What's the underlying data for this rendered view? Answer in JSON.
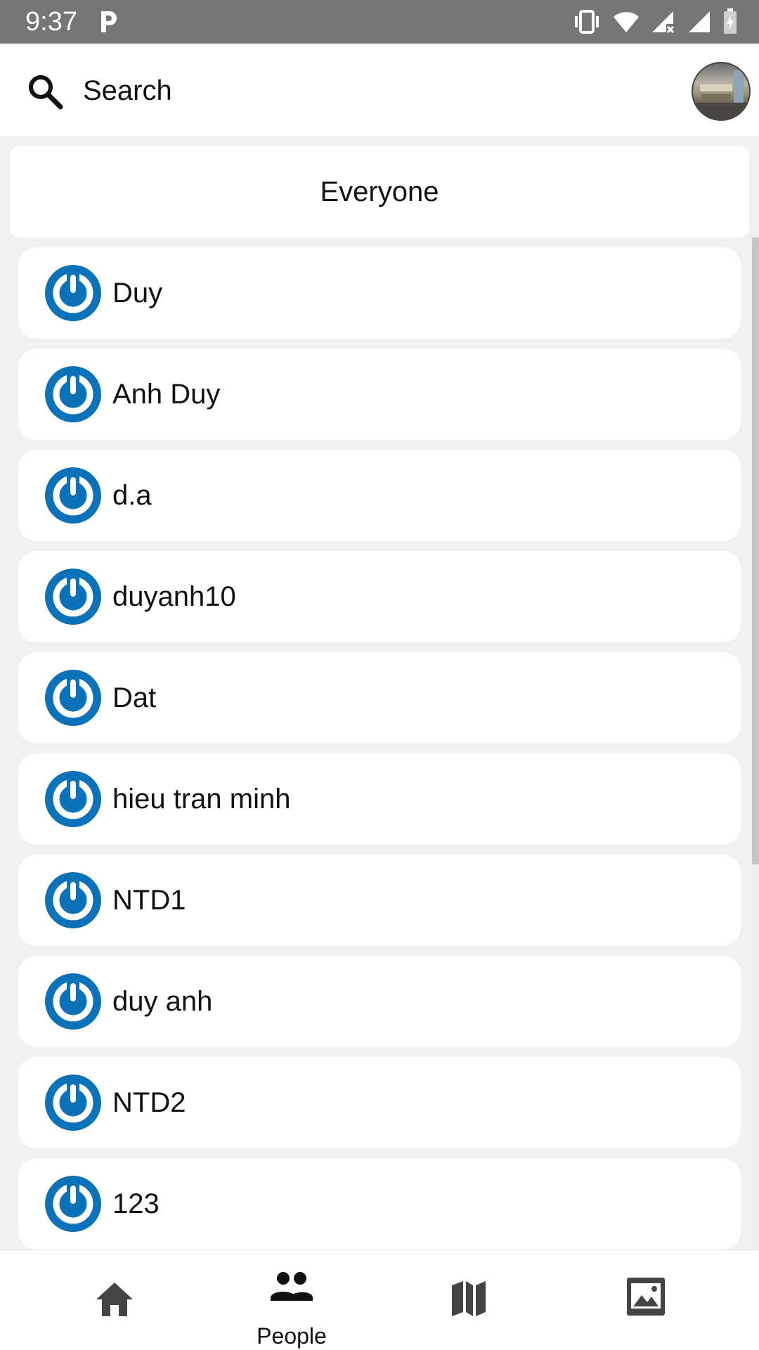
{
  "status_bar": {
    "time": "9:37"
  },
  "search": {
    "label": "Search"
  },
  "filter": {
    "label": "Everyone"
  },
  "people": [
    {
      "name": "Duy"
    },
    {
      "name": "Anh Duy"
    },
    {
      "name": "d.a"
    },
    {
      "name": "duyanh10"
    },
    {
      "name": "Dat"
    },
    {
      "name": "hieu tran minh"
    },
    {
      "name": "NTD1"
    },
    {
      "name": "duy anh"
    },
    {
      "name": "NTD2"
    },
    {
      "name": "123"
    }
  ],
  "bottom_nav": [
    {
      "icon": "home-icon",
      "label": ""
    },
    {
      "icon": "people-icon",
      "label": "People"
    },
    {
      "icon": "map-icon",
      "label": ""
    },
    {
      "icon": "image-icon",
      "label": ""
    }
  ],
  "colors": {
    "accent": "#0b72b9",
    "status_bar": "#767676"
  }
}
